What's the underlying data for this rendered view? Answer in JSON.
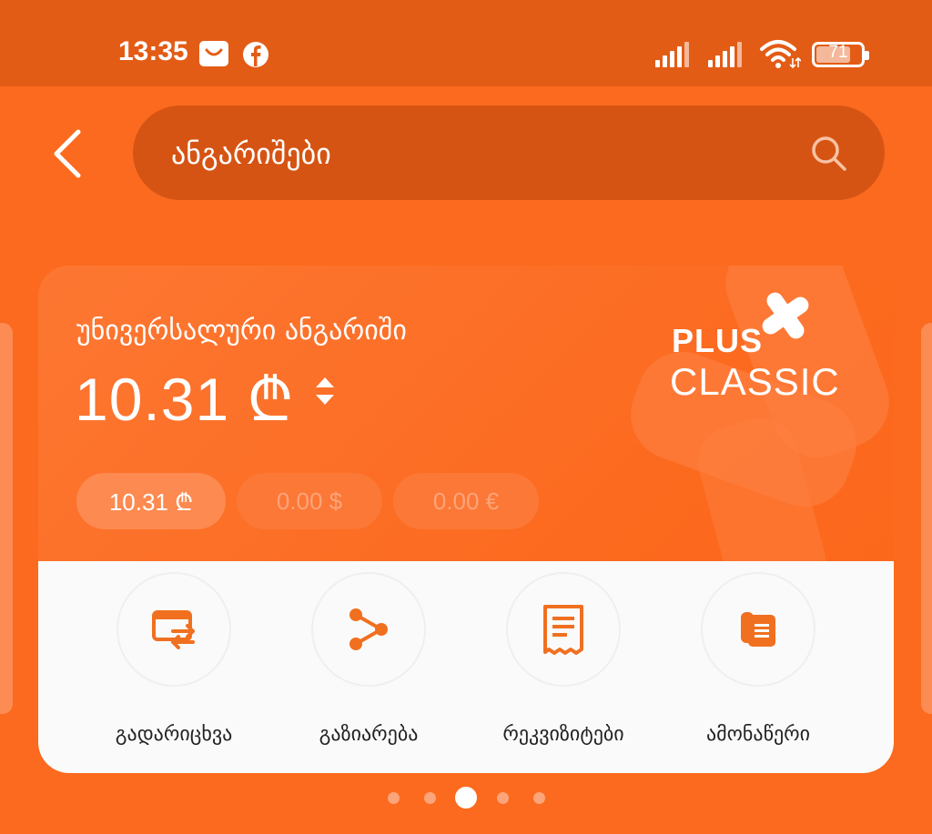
{
  "status_bar": {
    "time": "13:35",
    "battery_level": "71"
  },
  "header": {
    "search_title": "ანგარიშები"
  },
  "account": {
    "name": "უნივერსალური ანგარიში",
    "balance": "10.31 ₾",
    "brand_line1": "PLUS",
    "brand_line2": "CLASSIC",
    "currency_chips": [
      "10.31 ₾",
      "0.00 $",
      "0.00 €"
    ]
  },
  "actions": [
    {
      "label": "გადარიცხვა",
      "icon": "transfer-icon"
    },
    {
      "label": "გაზიარება",
      "icon": "share-icon"
    },
    {
      "label": "რეკვიზიტები",
      "icon": "receipt-icon"
    },
    {
      "label": "ამონაწერი",
      "icon": "statement-icon"
    }
  ],
  "pager": {
    "total": 5,
    "active": 3
  },
  "colors": {
    "accent": "#fb6a1e",
    "status_bar": "#e35c16",
    "search_bg": "#d65413",
    "icon_orange": "#f07020"
  }
}
